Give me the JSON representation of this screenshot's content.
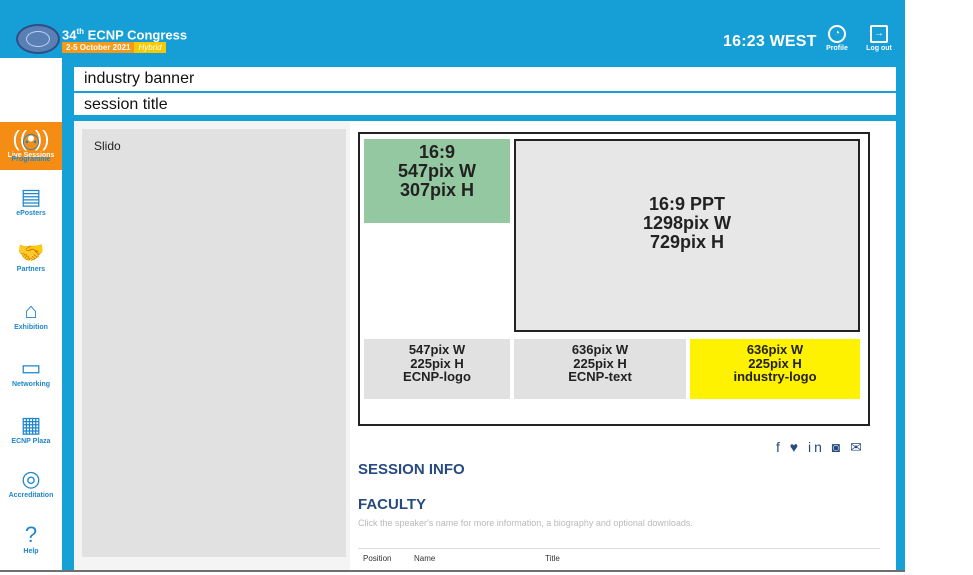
{
  "header": {
    "congress_title": "34",
    "congress_title_suffix": "th",
    "congress_name": " ECNP Congress",
    "date": "2-5 October 2021",
    "mode": "Hybrid",
    "time": "16:23 WEST",
    "profile_label": "Profile",
    "logout_label": "Log out"
  },
  "sidebar": {
    "items": [
      {
        "label": "Live\nSessions",
        "icon": "live-sessions-icon"
      },
      {
        "label": "Programme",
        "icon": "programme-icon"
      },
      {
        "label": "ePosters",
        "icon": "eposters-icon"
      },
      {
        "label": "Partners",
        "icon": "partners-icon"
      },
      {
        "label": "Exhibition",
        "icon": "exhibition-icon"
      },
      {
        "label": "Networking",
        "icon": "networking-icon"
      },
      {
        "label": "ECNP Plaza",
        "icon": "ecnp-plaza-icon"
      },
      {
        "label": "Accreditation",
        "icon": "accreditation-icon"
      },
      {
        "label": "Help",
        "icon": "help-icon"
      }
    ]
  },
  "strips": {
    "industry_banner": "industry banner",
    "session_title": "session title"
  },
  "main": {
    "slido_label": "Slido",
    "layout": {
      "green_line1": "16:9",
      "green_line2": "547pix W",
      "green_line3": "307pix H",
      "ppt_line1": "16:9 PPT",
      "ppt_line2": "1298pix W",
      "ppt_line3": "729pix H",
      "logo_line1": "547pix W",
      "logo_line2": "225pix H",
      "logo_line3": "ECNP-logo",
      "text_line1": "636pix W",
      "text_line2": "225pix H",
      "text_line3": "ECNP-text",
      "industry_line1": "636pix W",
      "industry_line2": "225pix H",
      "industry_line3": "industry-logo"
    },
    "session_info": "SESSION INFO",
    "faculty": "FACULTY",
    "faculty_subtitle": "Click the speaker's name for more information, a biography and optional downloads.",
    "table_headers": [
      "Position",
      "Name",
      "Title"
    ],
    "social_icons": [
      "facebook-icon",
      "twitter-icon",
      "linkedin-icon",
      "instagram-icon",
      "email-icon"
    ]
  }
}
